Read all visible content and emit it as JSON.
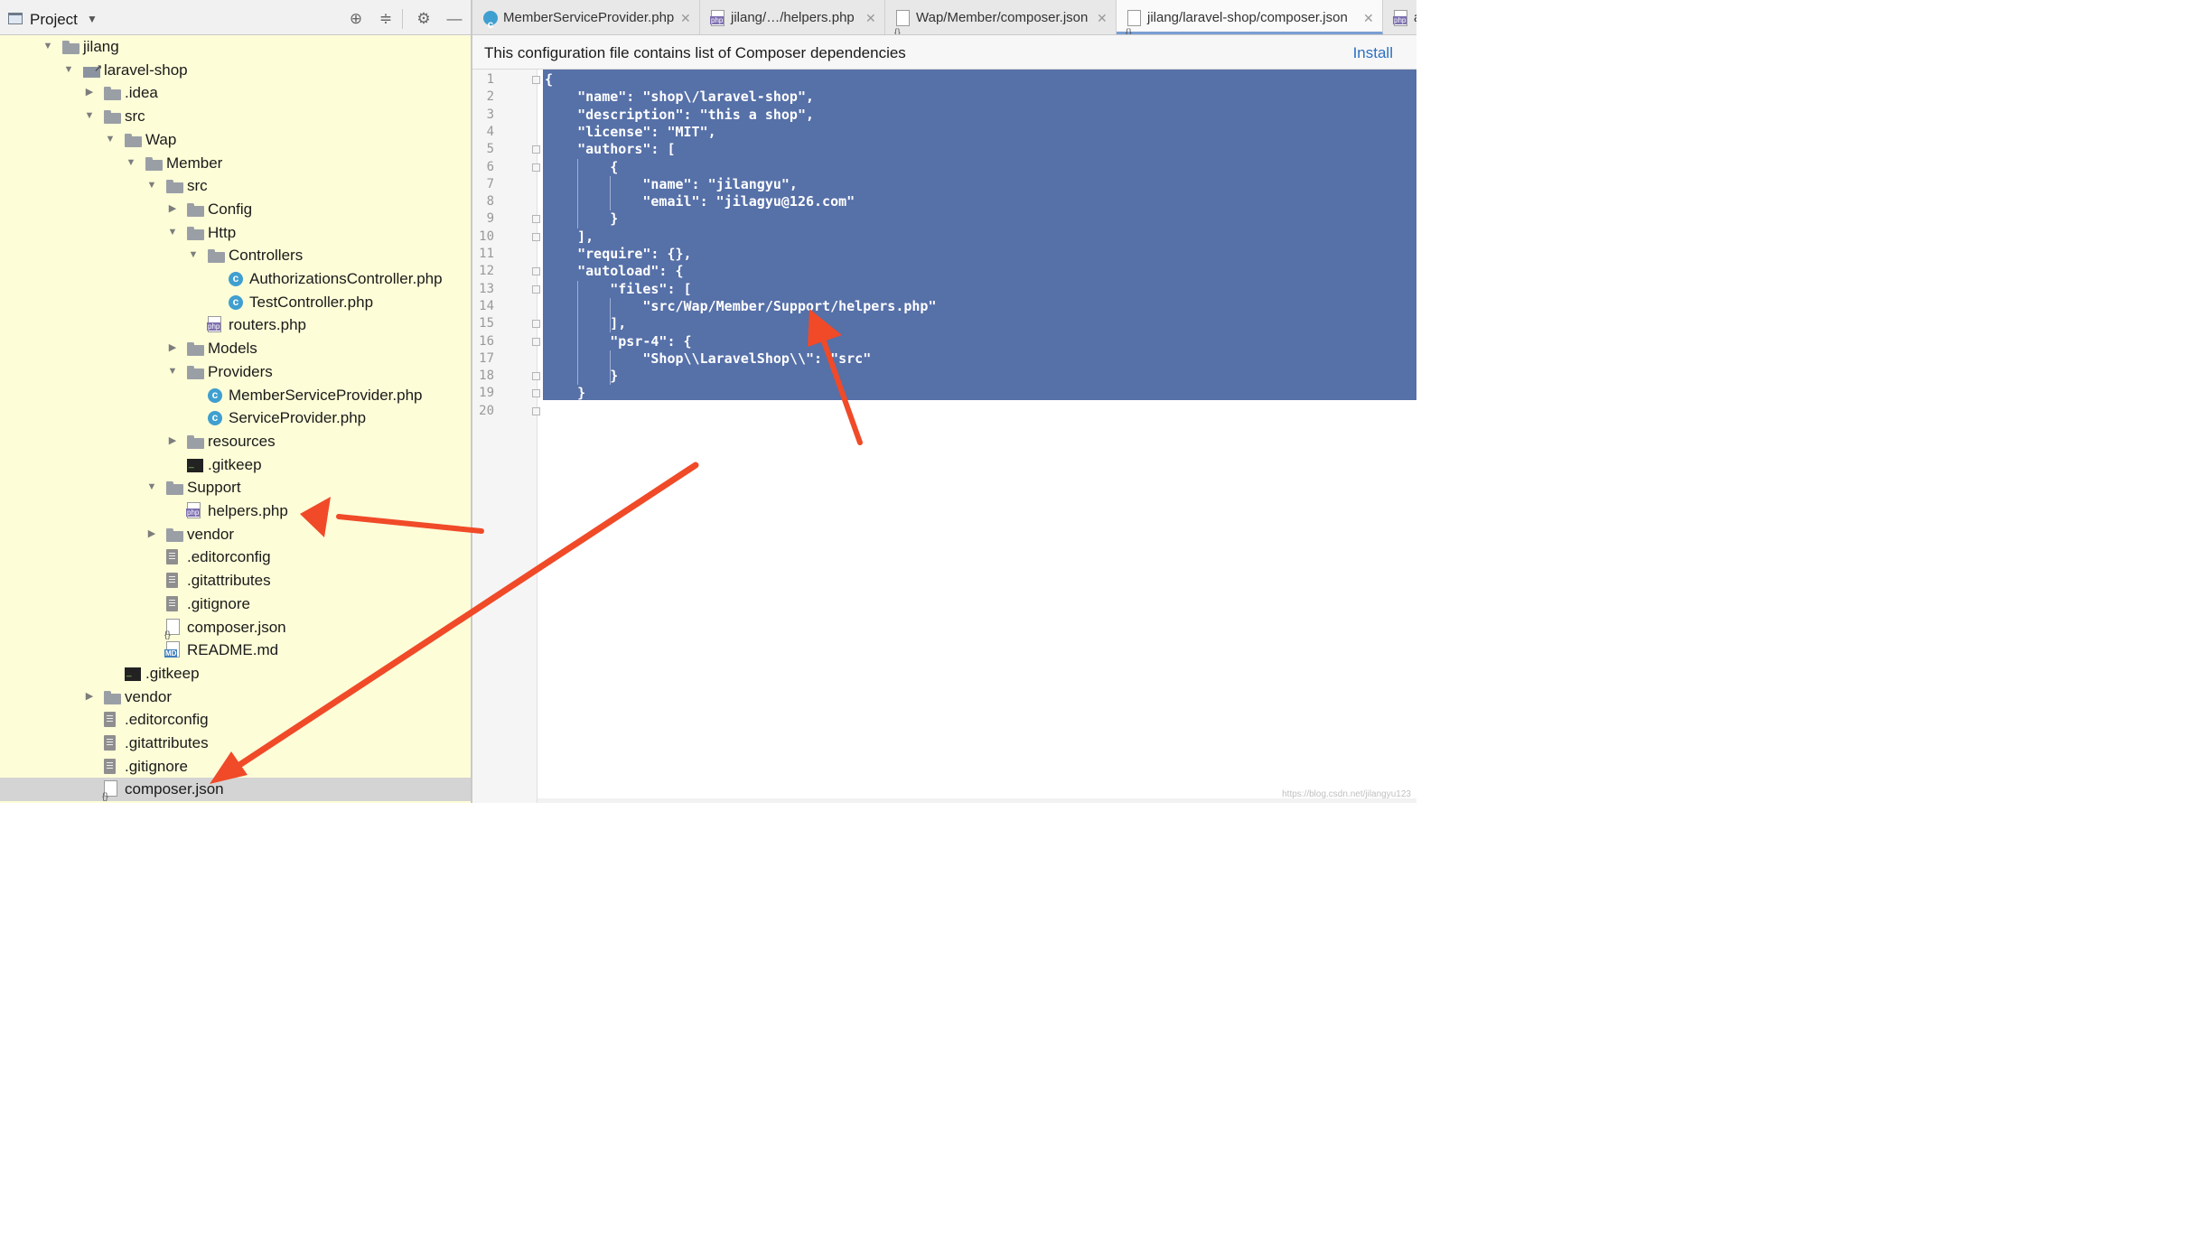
{
  "project_panel": {
    "title": "Project",
    "tree": [
      {
        "label": "jilang",
        "icon": "folder",
        "depth": 0,
        "arrow": "down"
      },
      {
        "label": "laravel-shop",
        "icon": "module",
        "depth": 1,
        "arrow": "down"
      },
      {
        "label": ".idea",
        "icon": "folder",
        "depth": 2,
        "arrow": "right"
      },
      {
        "label": "src",
        "icon": "folder",
        "depth": 2,
        "arrow": "down"
      },
      {
        "label": "Wap",
        "icon": "folder",
        "depth": 3,
        "arrow": "down"
      },
      {
        "label": "Member",
        "icon": "folder",
        "depth": 4,
        "arrow": "down"
      },
      {
        "label": "src",
        "icon": "folder",
        "depth": 5,
        "arrow": "down"
      },
      {
        "label": "Config",
        "icon": "folder",
        "depth": 6,
        "arrow": "right"
      },
      {
        "label": "Http",
        "icon": "folder",
        "depth": 6,
        "arrow": "down"
      },
      {
        "label": "Controllers",
        "icon": "folder",
        "depth": 7,
        "arrow": "down"
      },
      {
        "label": "AuthorizationsController.php",
        "icon": "cls",
        "depth": 8,
        "arrow": ""
      },
      {
        "label": "TestController.php",
        "icon": "cls",
        "depth": 8,
        "arrow": ""
      },
      {
        "label": "routers.php",
        "icon": "php",
        "depth": 7,
        "arrow": ""
      },
      {
        "label": "Models",
        "icon": "folder",
        "depth": 6,
        "arrow": "right"
      },
      {
        "label": "Providers",
        "icon": "folder",
        "depth": 6,
        "arrow": "down"
      },
      {
        "label": "MemberServiceProvider.php",
        "icon": "cls",
        "depth": 7,
        "arrow": ""
      },
      {
        "label": "ServiceProvider.php",
        "icon": "cls",
        "depth": 7,
        "arrow": ""
      },
      {
        "label": "resources",
        "icon": "folder",
        "depth": 6,
        "arrow": "right"
      },
      {
        "label": ".gitkeep",
        "icon": "term",
        "depth": 6,
        "arrow": ""
      },
      {
        "label": "Support",
        "icon": "folder",
        "depth": 5,
        "arrow": "down"
      },
      {
        "label": "helpers.php",
        "icon": "php",
        "depth": 6,
        "arrow": ""
      },
      {
        "label": "vendor",
        "icon": "folder",
        "depth": 5,
        "arrow": "right"
      },
      {
        "label": ".editorconfig",
        "icon": "txt",
        "depth": 5,
        "arrow": ""
      },
      {
        "label": ".gitattributes",
        "icon": "txt",
        "depth": 5,
        "arrow": ""
      },
      {
        "label": ".gitignore",
        "icon": "txt",
        "depth": 5,
        "arrow": ""
      },
      {
        "label": "composer.json",
        "icon": "json",
        "depth": 5,
        "arrow": ""
      },
      {
        "label": "README.md",
        "icon": "md",
        "depth": 5,
        "arrow": ""
      },
      {
        "label": ".gitkeep",
        "icon": "term",
        "depth": 3,
        "arrow": ""
      },
      {
        "label": "vendor",
        "icon": "folder",
        "depth": 2,
        "arrow": "right"
      },
      {
        "label": ".editorconfig",
        "icon": "txt",
        "depth": 2,
        "arrow": ""
      },
      {
        "label": ".gitattributes",
        "icon": "txt",
        "depth": 2,
        "arrow": ""
      },
      {
        "label": ".gitignore",
        "icon": "txt",
        "depth": 2,
        "arrow": ""
      },
      {
        "label": "composer.json",
        "icon": "json",
        "depth": 2,
        "arrow": "",
        "selected": true
      }
    ]
  },
  "tabs": [
    {
      "label": "MemberServiceProvider.php",
      "icon": "cls",
      "close": "✕"
    },
    {
      "label": "jilang/…/helpers.php",
      "icon": "php",
      "close": "✕"
    },
    {
      "label": "Wap/Member/composer.json",
      "icon": "json",
      "close": "✕"
    },
    {
      "label": "jilang/laravel-shop/composer.json",
      "icon": "json",
      "close": "✕",
      "active": true
    },
    {
      "label": "a",
      "icon": "php",
      "close": ""
    }
  ],
  "notification": {
    "message": "This configuration file contains list of Composer dependencies",
    "action": "Install"
  },
  "editor": {
    "current_line": 19,
    "lines": [
      "{",
      "    \"name\": \"shop\\/laravel-shop\",",
      "    \"description\": \"this a shop\",",
      "    \"license\": \"MIT\",",
      "    \"authors\": [",
      "        {",
      "            \"name\": \"jilangyu\",",
      "            \"email\": \"jilagyu@126.com\"",
      "        }",
      "    ],",
      "    \"require\": {},",
      "    \"autoload\": {",
      "        \"files\": [",
      "            \"src/Wap/Member/Support/helpers.php\"",
      "        ],",
      "        \"psr-4\": {",
      "            \"Shop\\\\LaravelShop\\\\\": \"src\"",
      "        }",
      "    }",
      "}"
    ],
    "fold_markers": [
      1,
      5,
      6,
      9,
      10,
      12,
      13,
      15,
      16,
      18,
      19,
      20
    ]
  },
  "watermark": "https://blog.csdn.net/jilangyu123",
  "colors": {
    "selection": "#5670a8",
    "project_bg": "#fdfdd8",
    "annotation_arrow": "#f04a28",
    "link": "#2a70c2"
  }
}
